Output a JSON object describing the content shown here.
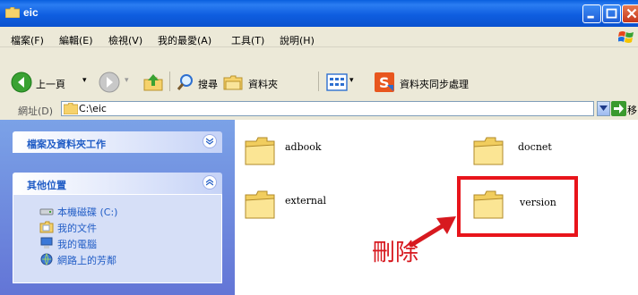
{
  "window": {
    "title": "eic",
    "controls": [
      "minimize",
      "maximize",
      "close"
    ]
  },
  "menu": {
    "items": [
      "檔案(F)",
      "編輯(E)",
      "檢視(V)",
      "我的最愛(A)",
      "工具(T)",
      "說明(H)"
    ]
  },
  "toolbar": {
    "back_label": "上一頁",
    "search_label": "搜尋",
    "folders_label": "資料夾",
    "sync_label": "資料夾同步處理"
  },
  "address": {
    "label": "網址(D)",
    "value": "C:\\eic",
    "go_label": "移至"
  },
  "task_pane": {
    "file_tasks_title": "檔案及資料夾工作",
    "other_places_title": "其他位置",
    "places": [
      "本機磁碟 (C:)",
      "我的文件",
      "我的電腦",
      "網路上的芳鄰"
    ]
  },
  "folders": [
    "adbook",
    "docnet",
    "external",
    "version"
  ],
  "annotation": {
    "text": "刪除",
    "color": "#e8141b"
  },
  "colors": {
    "title_bar": "#0a52cf",
    "pane_header_text": "#215dc6",
    "chrome": "#ece9d8"
  }
}
